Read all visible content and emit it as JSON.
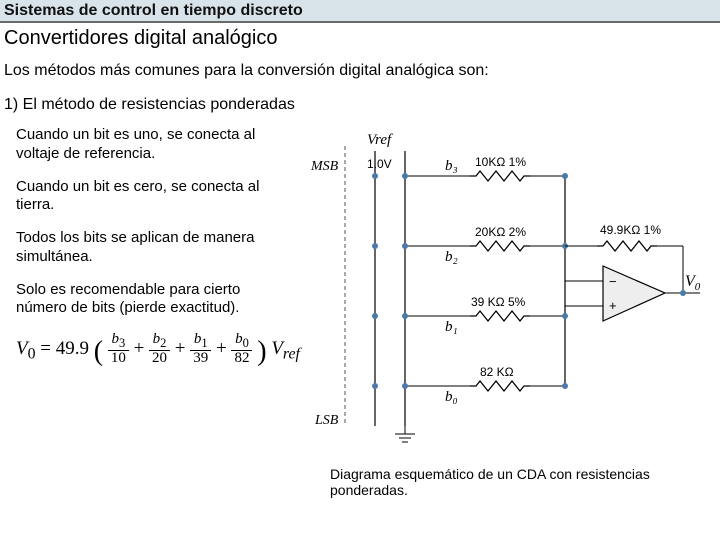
{
  "header": "Sistemas de control en tiempo discreto",
  "title": "Convertidores digital analógico",
  "intro": "Los métodos más comunes para la conversión digital analógica son:",
  "section": "1) El método de resistencias ponderadas",
  "paras": {
    "p1": "Cuando un bit es uno, se conecta al voltaje de referencia.",
    "p2": "Cuando un bit es cero, se conecta al tierra.",
    "p3": "Todos los bits se aplican de manera simultánea.",
    "p4": "Solo es recomendable para cierto número de bits (pierde exactitud)."
  },
  "formula": {
    "lhs": "V",
    "lhs_sub": "0",
    "eq": " = 49.9",
    "open": "(",
    "t1n": "b",
    "t1ns": "3",
    "t1d": "10",
    "t2n": "b",
    "t2ns": "2",
    "t2d": "20",
    "t3n": "b",
    "t3ns": "1",
    "t3d": "39",
    "t4n": "b",
    "t4ns": "0",
    "t4d": "82",
    "close": ")",
    "vref": "V",
    "vrefs": "ref"
  },
  "schem": {
    "msb": "MSB",
    "lsb": "LSB",
    "vref": "Vref",
    "vref_val": "1.0V",
    "r1": "10KΩ 1%",
    "r2": "20KΩ 2%",
    "r3": "39 KΩ 5%",
    "r4": "82 KΩ",
    "rf": "49.9KΩ 1%",
    "b3": "b₃",
    "b2": "b₂",
    "b1": "b₁",
    "b0": "b₀",
    "vout": "V",
    "vout_sub": "0",
    "minus": "−",
    "plus": "+"
  },
  "caption": "Diagrama esquemático de un CDA con resistencias ponderadas."
}
